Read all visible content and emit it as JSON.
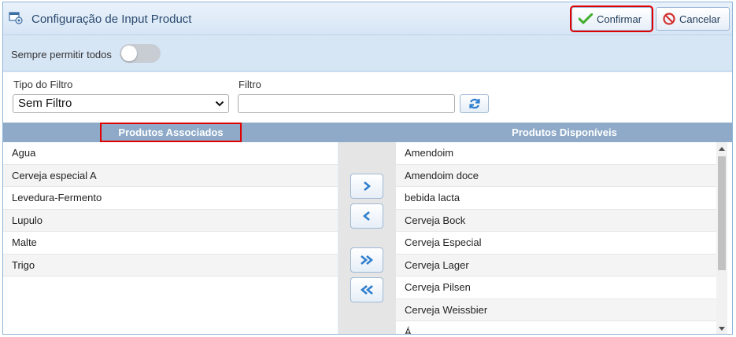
{
  "window": {
    "title": "Configuração de Input Product",
    "confirm_label": "Confirmar",
    "cancel_label": "Cancelar"
  },
  "options": {
    "always_allow_label": "Sempre permitir todos",
    "always_allow_on": false
  },
  "filter": {
    "type_label": "Tipo do Filtro",
    "type_value": "Sem Filtro",
    "text_label": "Filtro",
    "text_value": ""
  },
  "lists": {
    "associated_header": "Produtos Associados",
    "available_header": "Produtos Disponíveis",
    "associated": [
      "Agua",
      "Cerveja especial A",
      "Levedura-Fermento",
      "Lupulo",
      "Malte",
      "Trigo"
    ],
    "available": [
      "Amendoim",
      "Amendoim doce",
      "bebida lacta",
      "Cerveja Bock",
      "Cerveja Especial",
      "Cerveja Lager",
      "Cerveja Pilsen",
      "Cerveja Weissbier",
      "Á..."
    ]
  },
  "icons": {
    "confirm": "check-icon",
    "cancel": "no-entry-icon",
    "refresh": "refresh-icon",
    "move_right": "chevron-right-icon",
    "move_left": "chevron-left-icon",
    "move_all_right": "double-chevron-right-icon",
    "move_all_left": "double-chevron-left-icon"
  },
  "colors": {
    "accent": "#2f7fcf",
    "header_bg": "#8eaac8",
    "highlight": "#e00000",
    "confirm_check": "#3fae2a",
    "cancel_red": "#d32f2f"
  }
}
